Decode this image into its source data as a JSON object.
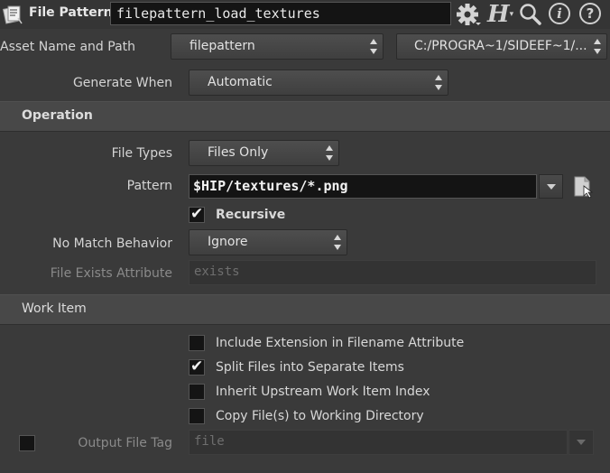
{
  "header": {
    "node_type_label": "File Pattern",
    "node_name": "filepattern_load_textures",
    "icons": [
      "file-pattern-node-icon",
      "gear-icon",
      "houdini-h-icon",
      "magnify-icon",
      "info-icon",
      "help-icon"
    ],
    "h_logo": "H",
    "info_glyph": "i",
    "help_glyph": "?"
  },
  "asset": {
    "label": "Asset Name and Path",
    "name_value": "filepattern",
    "path_value": "C:/PROGRA~1/SIDEEF~1/..."
  },
  "generate_when": {
    "label": "Generate When",
    "value": "Automatic"
  },
  "operation": {
    "title": "Operation",
    "file_types": {
      "label": "File Types",
      "value": "Files Only"
    },
    "pattern": {
      "label": "Pattern",
      "value": "$HIP/textures/*.png"
    },
    "recursive": {
      "label": "Recursive",
      "checked": true
    },
    "no_match": {
      "label": "No Match Behavior",
      "value": "Ignore"
    },
    "file_exists": {
      "label": "File Exists Attribute",
      "value": "exists"
    }
  },
  "work_item": {
    "title": "Work Item",
    "checkboxes": [
      {
        "label": "Include Extension in Filename Attribute",
        "checked": false
      },
      {
        "label": "Split Files into Separate Items",
        "checked": true
      },
      {
        "label": "Inherit Upstream Work Item Index",
        "checked": false
      },
      {
        "label": "Copy File(s) to Working Directory",
        "checked": false
      }
    ],
    "output_file_tag": {
      "label": "Output File Tag",
      "value": "file",
      "enabled": false
    }
  },
  "colors": {
    "background": "#3a3a3a",
    "section_bar": "#484848",
    "field": "#141414"
  }
}
